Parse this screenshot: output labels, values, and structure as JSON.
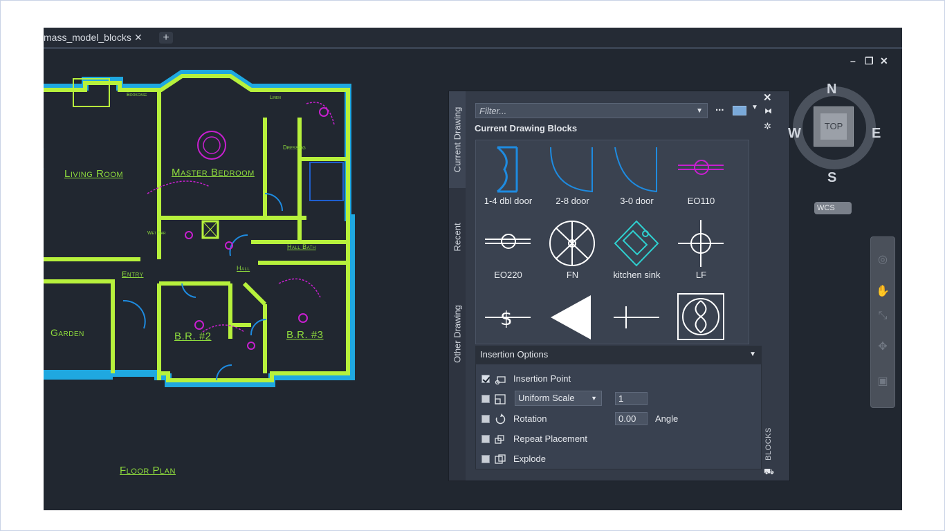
{
  "document_tab": {
    "title": "mass_model_blocks",
    "close_glyph": "✕",
    "new_tab_glyph": "+"
  },
  "window_controls": {
    "minimize": "–",
    "restore": "❐",
    "close": "✕"
  },
  "floor_plan": {
    "rooms": {
      "living_room": "Living Room",
      "master_bedroom": "Master Bedroom",
      "garden": "Garden",
      "entry": "Entry",
      "hall": "Hall",
      "hall_bath": "Hall Bath",
      "br2": "B.R. #2",
      "br3": "B.R. #3",
      "bookcase": "Bookcase",
      "linen": "Linen",
      "dressing": "Dressing",
      "wet_bar": "Wet Bar"
    },
    "title": "Floor Plan"
  },
  "palette": {
    "side_tabs": [
      "Current Drawing",
      "Recent",
      "Other Drawing"
    ],
    "filter_placeholder": "Filter...",
    "more_glyph": "...",
    "section_title": "Current Drawing Blocks",
    "blocks": [
      {
        "label": "1-4 dbl door",
        "icon": "double-door-icon"
      },
      {
        "label": "2-8 door",
        "icon": "door-swing-icon"
      },
      {
        "label": "3-0 door",
        "icon": "door-swing-icon"
      },
      {
        "label": "EO110",
        "icon": "outlet-icon"
      },
      {
        "label": "EO220",
        "icon": "outlet-220-icon"
      },
      {
        "label": "FN",
        "icon": "fan-icon"
      },
      {
        "label": "kitchen sink",
        "icon": "sink-icon"
      },
      {
        "label": "LF",
        "icon": "light-fixture-icon"
      },
      {
        "label": "",
        "icon": "switch-icon"
      },
      {
        "label": "",
        "icon": "triangle-icon"
      },
      {
        "label": "",
        "icon": "cross-line-icon"
      },
      {
        "label": "",
        "icon": "infinity-box-icon"
      }
    ],
    "insertion_options": {
      "header": "Insertion Options",
      "insertion_point": {
        "label": "Insertion Point",
        "checked": true
      },
      "scale": {
        "mode": "Uniform Scale",
        "value": "1",
        "checked": false
      },
      "rotation": {
        "label": "Rotation",
        "value": "0.00",
        "unit_label": "Angle",
        "checked": false
      },
      "repeat_placement": {
        "label": "Repeat Placement",
        "checked": false
      },
      "explode": {
        "label": "Explode",
        "checked": false
      }
    },
    "vertical_title": "BLOCKS"
  },
  "viewcube": {
    "north": "N",
    "south": "S",
    "east": "E",
    "west": "W",
    "face": "TOP",
    "wcs": "WCS"
  },
  "colors": {
    "wall": "#b7f13c",
    "wall_outline": "#1fa8e0",
    "fixture": "#c71fcf",
    "text": "#8fdc3d",
    "door": "#1e8be0",
    "background": "#212730"
  }
}
